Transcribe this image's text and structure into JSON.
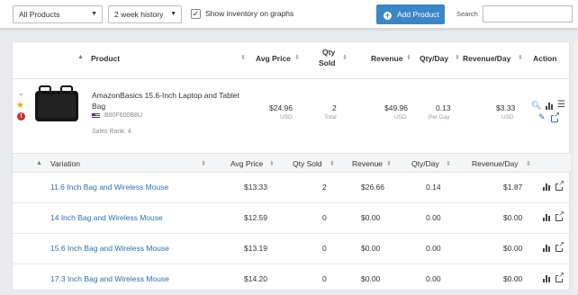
{
  "toolbar": {
    "product_filter": "All Products",
    "history_filter": "2 week history",
    "show_inventory_label": "Show inventory on graphs",
    "show_inventory_checked": true,
    "add_product_label": "Add Product",
    "search_label": "Search",
    "search_value": ""
  },
  "table": {
    "headers": {
      "product": "Product",
      "avg_price": "Avg Price",
      "qty_sold_1": "Qty",
      "qty_sold_2": "Sold",
      "revenue": "Revenue",
      "qty_day": "Qty/Day",
      "revenue_day": "Revenue/Day",
      "action": "Action"
    },
    "product": {
      "name_line1": "AmazonBasics 15.6-Inch Laptop and Tablet",
      "name_line2": "Bag",
      "asin": "B00F600B8U",
      "sales_rank": "Sales Rank: 4",
      "avg_price": "$24.96",
      "avg_price_unit": "USD",
      "qty_sold": "2",
      "qty_sold_unit": "Total",
      "revenue": "$49.96",
      "revenue_unit": "USD",
      "qty_day": "0.13",
      "qty_day_unit": "Per Day",
      "revenue_day": "$3.33",
      "revenue_day_unit": "USD"
    }
  },
  "variations": {
    "headers": {
      "variation": "Variation",
      "avg_price": "Avg Price",
      "qty_sold": "Qty Sold",
      "revenue": "Revenue",
      "qty_day": "Qty/Day",
      "revenue_day": "Revenue/Day"
    },
    "rows": [
      {
        "name": "11.6 Inch Bag and Wireless Mouse",
        "avg_price": "$13.33",
        "qty_sold": "2",
        "revenue": "$26.66",
        "qty_day": "0.14",
        "revenue_day": "$1.87"
      },
      {
        "name": "14 Inch Bag and Wireless Mouse",
        "avg_price": "$12.59",
        "qty_sold": "0",
        "revenue": "$0.00",
        "qty_day": "0.00",
        "revenue_day": "$0.00"
      },
      {
        "name": "15.6 Inch Bag and Wireless Mouse",
        "avg_price": "$13.19",
        "qty_sold": "0",
        "revenue": "$0.00",
        "qty_day": "0.00",
        "revenue_day": "$0.00"
      },
      {
        "name": "17.3 Inch Bag and Wireless Mouse",
        "avg_price": "$14.20",
        "qty_sold": "0",
        "revenue": "$0.00",
        "qty_day": "0.00",
        "revenue_day": "$0.00"
      }
    ]
  },
  "colors": {
    "accent": "#3a87c8",
    "link": "#2f6fae",
    "star": "#f0a31c",
    "alert": "#c9302c"
  }
}
